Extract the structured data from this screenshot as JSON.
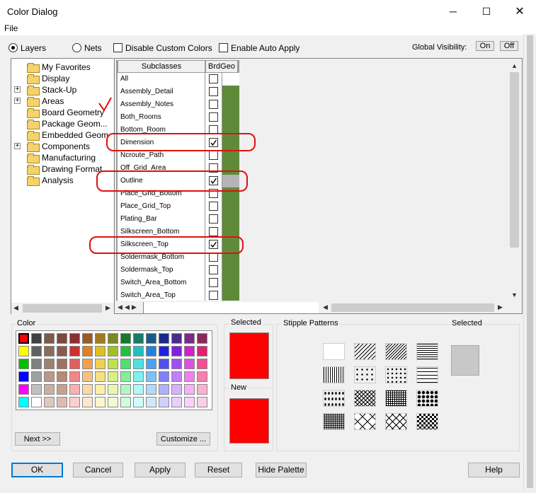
{
  "window": {
    "title": "Color Dialog",
    "minimize_icon": "minimize-icon",
    "maximize_icon": "maximize-icon",
    "close_icon": "close-icon"
  },
  "menu": {
    "file": "File"
  },
  "top": {
    "layers_label": "Layers",
    "layers_selected": true,
    "nets_label": "Nets",
    "disable_custom_colors": "Disable Custom Colors",
    "enable_auto_apply": "Enable Auto Apply",
    "global_visibility": "Global Visibility:",
    "on": "On",
    "off": "Off"
  },
  "tree": [
    {
      "label": "My Favorites",
      "expandable": false
    },
    {
      "label": "Display",
      "expandable": false
    },
    {
      "label": "Stack-Up",
      "expandable": true
    },
    {
      "label": "Areas",
      "expandable": true
    },
    {
      "label": "Board Geometry",
      "expandable": false
    },
    {
      "label": "Package Geom...",
      "expandable": false
    },
    {
      "label": "Embedded Geom",
      "expandable": false
    },
    {
      "label": "Components",
      "expandable": true
    },
    {
      "label": "Manufacturing",
      "expandable": false
    },
    {
      "label": "Drawing Format",
      "expandable": false
    },
    {
      "label": "Analysis",
      "expandable": false
    }
  ],
  "grid": {
    "col_subclasses": "Subclasses",
    "col_brdgeo": "BrdGeo",
    "rows": [
      {
        "name": "All",
        "checked": false
      },
      {
        "name": "Assembly_Detail",
        "checked": false
      },
      {
        "name": "Assembly_Notes",
        "checked": false
      },
      {
        "name": "Both_Rooms",
        "checked": false
      },
      {
        "name": "Bottom_Room",
        "checked": false
      },
      {
        "name": "Dimension",
        "checked": true
      },
      {
        "name": "Ncroute_Path",
        "checked": false
      },
      {
        "name": "Off_Grid_Area",
        "checked": false
      },
      {
        "name": "Outline",
        "checked": true
      },
      {
        "name": "Place_Grid_Bottom",
        "checked": false
      },
      {
        "name": "Place_Grid_Top",
        "checked": false
      },
      {
        "name": "Plating_Bar",
        "checked": false
      },
      {
        "name": "Silkscreen_Bottom",
        "checked": false
      },
      {
        "name": "Silkscreen_Top",
        "checked": true
      },
      {
        "name": "Soldermask_Bottom",
        "checked": false
      },
      {
        "name": "Soldermask_Top",
        "checked": false
      },
      {
        "name": "Switch_Area_Bottom",
        "checked": false
      },
      {
        "name": "Switch_Area_Top",
        "checked": false
      }
    ],
    "layer_color": "#5f8a3a",
    "outline_color": "#b4b4b4"
  },
  "color_panel": {
    "label": "Color",
    "next": "Next >>",
    "customize": "Customize ...",
    "palette": [
      [
        "#ff0000",
        "#404040",
        "#7b5b4b",
        "#7b4a3f",
        "#8b2f2f",
        "#9b5a28",
        "#a07a20",
        "#7a8a20",
        "#157a2a",
        "#1a7a6a",
        "#1a5a8a",
        "#1a2a8a",
        "#4a2a8a",
        "#7a2a8a",
        "#8a2a5a"
      ],
      [
        "#ffff00",
        "#606060",
        "#8b6b5b",
        "#8b5a4f",
        "#cc3030",
        "#e08020",
        "#e0c020",
        "#a0c020",
        "#20c040",
        "#20c0c0",
        "#2080e0",
        "#2020e0",
        "#8020e0",
        "#d020d0",
        "#e02070"
      ],
      [
        "#00c000",
        "#808080",
        "#a08070",
        "#a07060",
        "#e06060",
        "#f0a050",
        "#f0d050",
        "#c0e050",
        "#50e070",
        "#50e0e0",
        "#50a0f0",
        "#5050f0",
        "#a050f0",
        "#e050e0",
        "#f05090"
      ],
      [
        "#0000ff",
        "#a0a0a0",
        "#b89888",
        "#b88878",
        "#f08888",
        "#f8c080",
        "#f8e080",
        "#d8f080",
        "#80f098",
        "#80f0f0",
        "#80c0f8",
        "#8080f8",
        "#c080f8",
        "#f080f0",
        "#f880b0"
      ],
      [
        "#ff00ff",
        "#c0c0c0",
        "#c8b0a0",
        "#c8a090",
        "#f8b0b0",
        "#fcd8a8",
        "#fcf0a8",
        "#e8f8b0",
        "#b0f8c0",
        "#b0f8f8",
        "#b0d8fc",
        "#b0b0fc",
        "#d8b0fc",
        "#f8b0f8",
        "#fcb0d0"
      ],
      [
        "#00ffff",
        "#ffffff",
        "#dcc8bc",
        "#dcbcb0",
        "#fcd0d0",
        "#fce8cc",
        "#fcf8cc",
        "#f0fcd0",
        "#d0fcdc",
        "#d0fcfc",
        "#d0e8fc",
        "#d0d0fc",
        "#e8d0fc",
        "#fcd0fc",
        "#fcd0e4"
      ]
    ]
  },
  "selected_panel": {
    "selected": "Selected",
    "new": "New",
    "selected_color": "#ff0000",
    "new_color": "#ff0000"
  },
  "stipple": {
    "label": "Stipple Patterns",
    "selected": "Selected",
    "selected_color": "#c8c8c8"
  },
  "buttons": {
    "ok": "OK",
    "cancel": "Cancel",
    "apply": "Apply",
    "reset": "Reset",
    "hide_palette": "Hide Palette",
    "help": "Help"
  }
}
